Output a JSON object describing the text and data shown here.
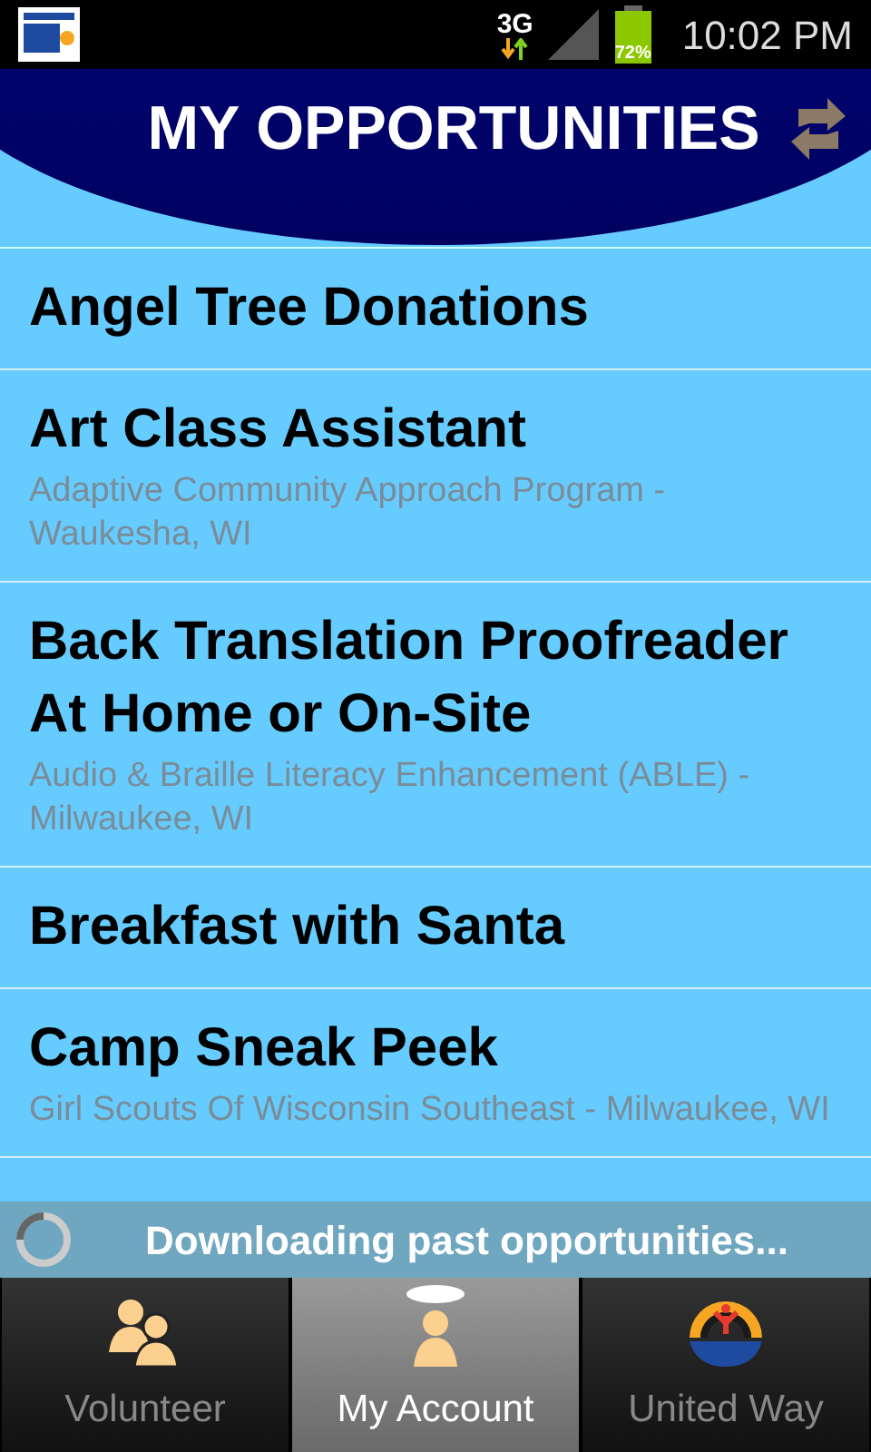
{
  "status_bar": {
    "network": "3G",
    "battery": "72%",
    "time": "10:02 PM"
  },
  "header": {
    "title": "MY OPPORTUNITIES"
  },
  "opportunities": [
    {
      "title": "Angel Tree Donations"
    },
    {
      "title": "Art Class Assistant",
      "organization": "Adaptive Community Approach Program - Waukesha, WI"
    },
    {
      "title": "Back Translation Proofreader At Home or On-Site",
      "organization": "Audio & Braille Literacy Enhancement (ABLE) - Milwaukee, WI"
    },
    {
      "title": "Breakfast with Santa"
    },
    {
      "title": "Camp Sneak Peek",
      "organization": "Girl Scouts Of Wisconsin Southeast - Milwaukee, WI"
    }
  ],
  "toast": {
    "message": "Downloading past opportunities..."
  },
  "tabs": [
    {
      "label": "Volunteer",
      "kind": "people",
      "selected": false
    },
    {
      "label": "My Account",
      "kind": "account",
      "selected": true
    },
    {
      "label": "United Way",
      "kind": "logo",
      "selected": false
    }
  ]
}
